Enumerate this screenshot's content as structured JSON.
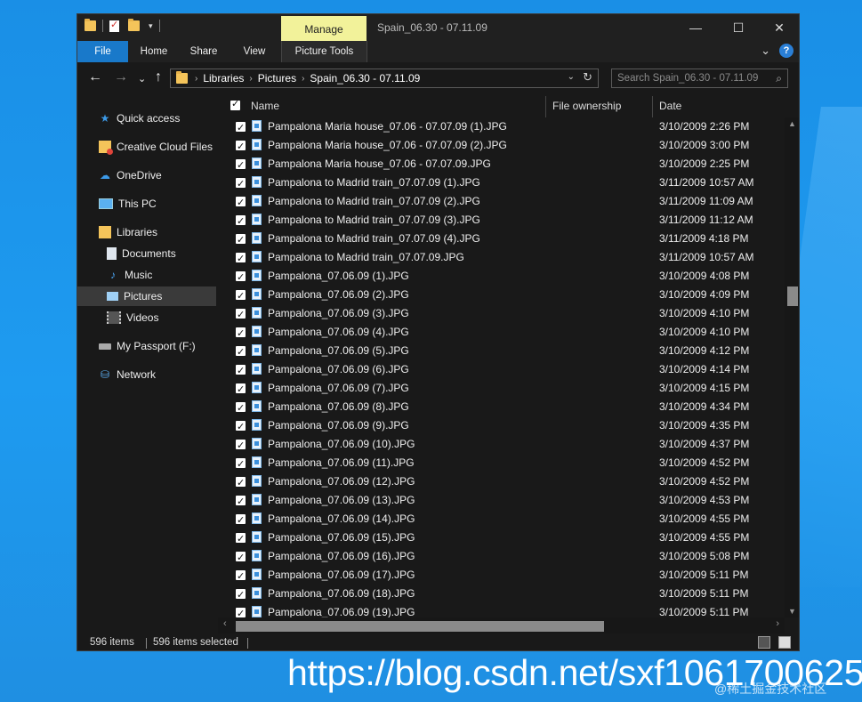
{
  "window": {
    "title": "Spain_06.30 - 07.11.09",
    "manage_tab": "Manage",
    "controls": {
      "minimize": "—",
      "maximize": "☐",
      "close": "✕"
    }
  },
  "ribbon": {
    "tabs": [
      "File",
      "Home",
      "Share",
      "View",
      "Picture Tools"
    ],
    "collapse_glyph": "⌄",
    "help_glyph": "?"
  },
  "nav": {
    "back": "←",
    "forward": "→",
    "recent": "⌄",
    "up": "↑",
    "breadcrumb": [
      "Libraries",
      "Pictures",
      "Spain_06.30 - 07.11.09"
    ],
    "search_placeholder": "Search Spain_06.30 - 07.11.09"
  },
  "sidebar": {
    "items": [
      {
        "label": "Quick access",
        "icon": "star-icon"
      },
      {
        "label": "Creative Cloud Files",
        "icon": "creative-cloud-folder-icon"
      },
      {
        "label": "OneDrive",
        "icon": "cloud-icon"
      },
      {
        "label": "This PC",
        "icon": "computer-icon"
      },
      {
        "label": "Libraries",
        "icon": "libraries-icon"
      },
      {
        "label": "Documents",
        "icon": "document-icon"
      },
      {
        "label": "Music",
        "icon": "music-note-icon"
      },
      {
        "label": "Pictures",
        "icon": "pictures-icon"
      },
      {
        "label": "Videos",
        "icon": "film-icon"
      },
      {
        "label": "My Passport (F:)",
        "icon": "drive-icon"
      },
      {
        "label": "Network",
        "icon": "network-icon"
      }
    ],
    "selected": "Pictures"
  },
  "columns": {
    "name": "Name",
    "ownership": "File ownership",
    "date": "Date"
  },
  "files": [
    {
      "name": "Pampalona Maria house_07.06 - 07.07.09 (1).JPG",
      "date": "3/10/2009 2:26 PM"
    },
    {
      "name": "Pampalona Maria house_07.06 - 07.07.09 (2).JPG",
      "date": "3/10/2009 3:00 PM"
    },
    {
      "name": "Pampalona Maria house_07.06 - 07.07.09.JPG",
      "date": "3/10/2009 2:25 PM"
    },
    {
      "name": "Pampalona to Madrid train_07.07.09 (1).JPG",
      "date": "3/11/2009 10:57 AM"
    },
    {
      "name": "Pampalona to Madrid train_07.07.09 (2).JPG",
      "date": "3/11/2009 11:09 AM"
    },
    {
      "name": "Pampalona to Madrid train_07.07.09 (3).JPG",
      "date": "3/11/2009 11:12 AM"
    },
    {
      "name": "Pampalona to Madrid train_07.07.09 (4).JPG",
      "date": "3/11/2009 4:18 PM"
    },
    {
      "name": "Pampalona to Madrid train_07.07.09.JPG",
      "date": "3/11/2009 10:57 AM"
    },
    {
      "name": "Pampalona_07.06.09 (1).JPG",
      "date": "3/10/2009 4:08 PM"
    },
    {
      "name": "Pampalona_07.06.09 (2).JPG",
      "date": "3/10/2009 4:09 PM"
    },
    {
      "name": "Pampalona_07.06.09 (3).JPG",
      "date": "3/10/2009 4:10 PM"
    },
    {
      "name": "Pampalona_07.06.09 (4).JPG",
      "date": "3/10/2009 4:10 PM"
    },
    {
      "name": "Pampalona_07.06.09 (5).JPG",
      "date": "3/10/2009 4:12 PM"
    },
    {
      "name": "Pampalona_07.06.09 (6).JPG",
      "date": "3/10/2009 4:14 PM"
    },
    {
      "name": "Pampalona_07.06.09 (7).JPG",
      "date": "3/10/2009 4:15 PM"
    },
    {
      "name": "Pampalona_07.06.09 (8).JPG",
      "date": "3/10/2009 4:34 PM"
    },
    {
      "name": "Pampalona_07.06.09 (9).JPG",
      "date": "3/10/2009 4:35 PM"
    },
    {
      "name": "Pampalona_07.06.09 (10).JPG",
      "date": "3/10/2009 4:37 PM"
    },
    {
      "name": "Pampalona_07.06.09 (11).JPG",
      "date": "3/10/2009 4:52 PM"
    },
    {
      "name": "Pampalona_07.06.09 (12).JPG",
      "date": "3/10/2009 4:52 PM"
    },
    {
      "name": "Pampalona_07.06.09 (13).JPG",
      "date": "3/10/2009 4:53 PM"
    },
    {
      "name": "Pampalona_07.06.09 (14).JPG",
      "date": "3/10/2009 4:55 PM"
    },
    {
      "name": "Pampalona_07.06.09 (15).JPG",
      "date": "3/10/2009 4:55 PM"
    },
    {
      "name": "Pampalona_07.06.09 (16).JPG",
      "date": "3/10/2009 5:08 PM"
    },
    {
      "name": "Pampalona_07.06.09 (17).JPG",
      "date": "3/10/2009 5:11 PM"
    },
    {
      "name": "Pampalona_07.06.09 (18).JPG",
      "date": "3/10/2009 5:11 PM"
    },
    {
      "name": "Pampalona_07.06.09 (19).JPG",
      "date": "3/10/2009 5:11 PM"
    }
  ],
  "status": {
    "count": "596 items",
    "selected": "596 items selected"
  },
  "watermark": {
    "url": "https://blog.csdn.net/sxf1061700625",
    "sub": "@稀土掘金技术社区"
  },
  "colors": {
    "accent": "#1979ca",
    "manage_tab": "#f2f29a",
    "window_bg": "#191919",
    "desktop": "#1e9bf0"
  }
}
